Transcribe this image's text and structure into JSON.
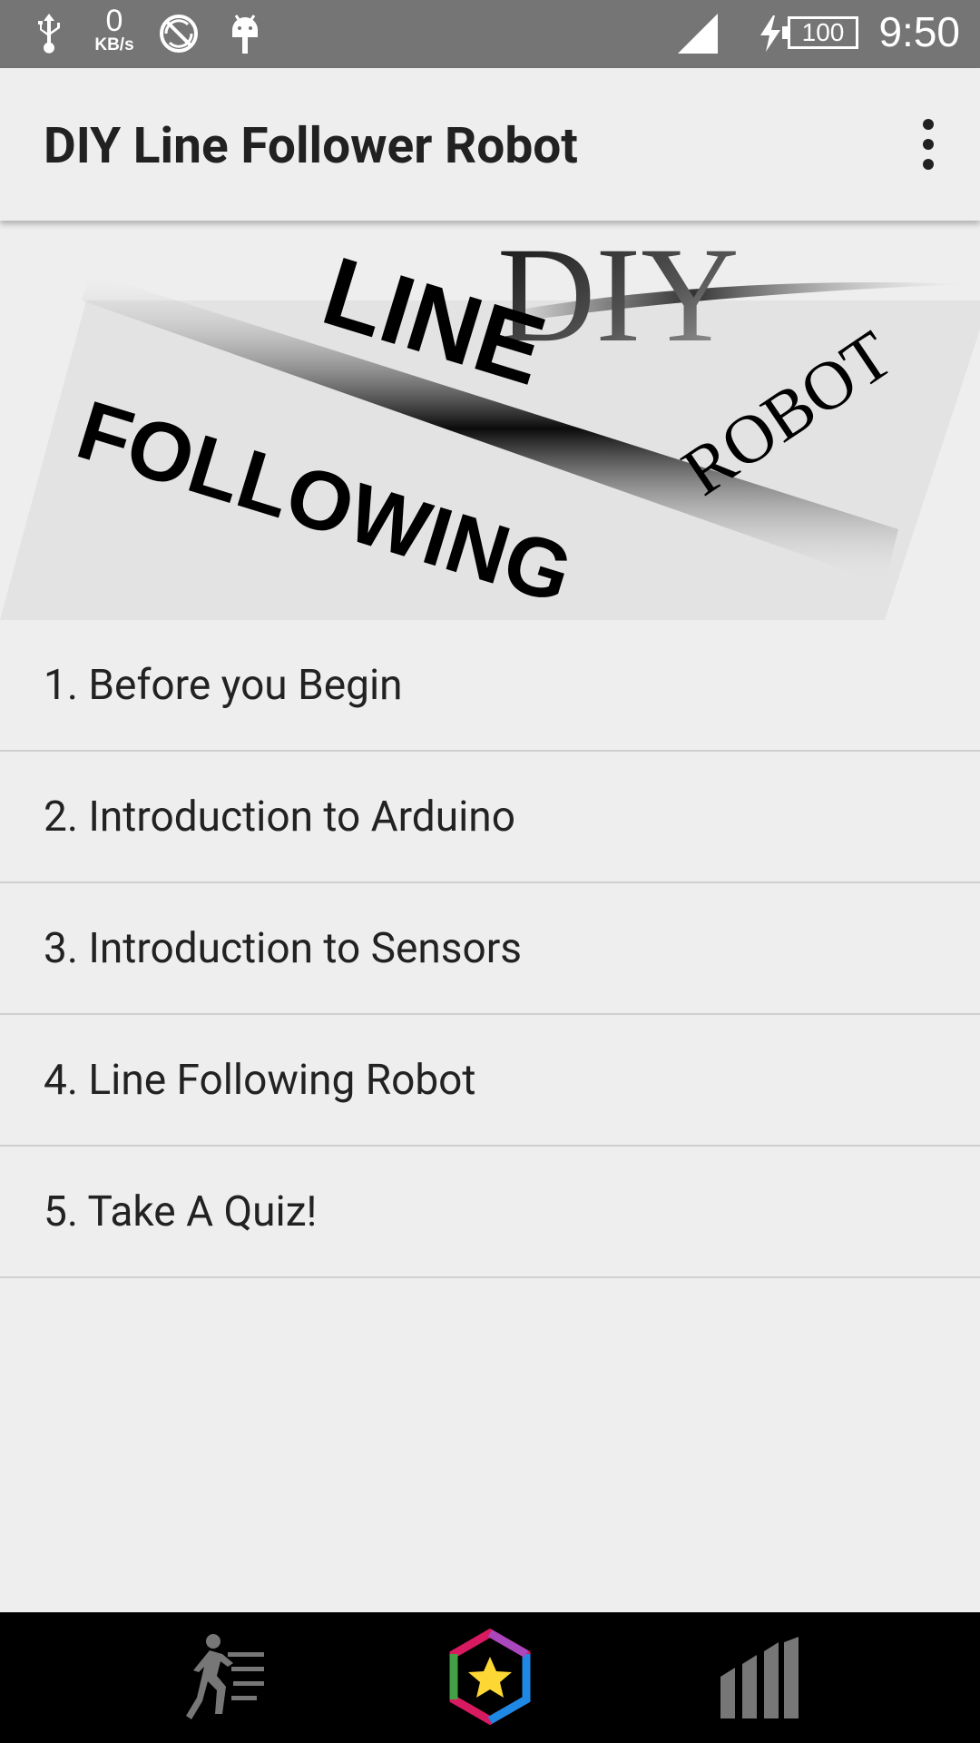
{
  "status_bar": {
    "time": "9:50",
    "battery": "100",
    "net_speed_value": "0",
    "net_speed_unit": "KB/s"
  },
  "app_bar": {
    "title": "DIY Line Follower Robot",
    "menu_icon": "more-vert-icon"
  },
  "banner": {
    "diy": "DIY",
    "line": "LINE",
    "following": "FOLLOWING",
    "robot": "ROBOT"
  },
  "menu_items": [
    {
      "label": "1. Before you Begin"
    },
    {
      "label": "2. Introduction to Arduino"
    },
    {
      "label": "3. Introduction to Sensors"
    },
    {
      "label": "4. Line Following Robot"
    },
    {
      "label": "5. Take A Quiz!"
    }
  ],
  "bottom_nav": {
    "items": [
      {
        "icon": "running-person-icon"
      },
      {
        "icon": "star-hexagon-icon"
      },
      {
        "icon": "bar-chart-icon"
      }
    ]
  }
}
